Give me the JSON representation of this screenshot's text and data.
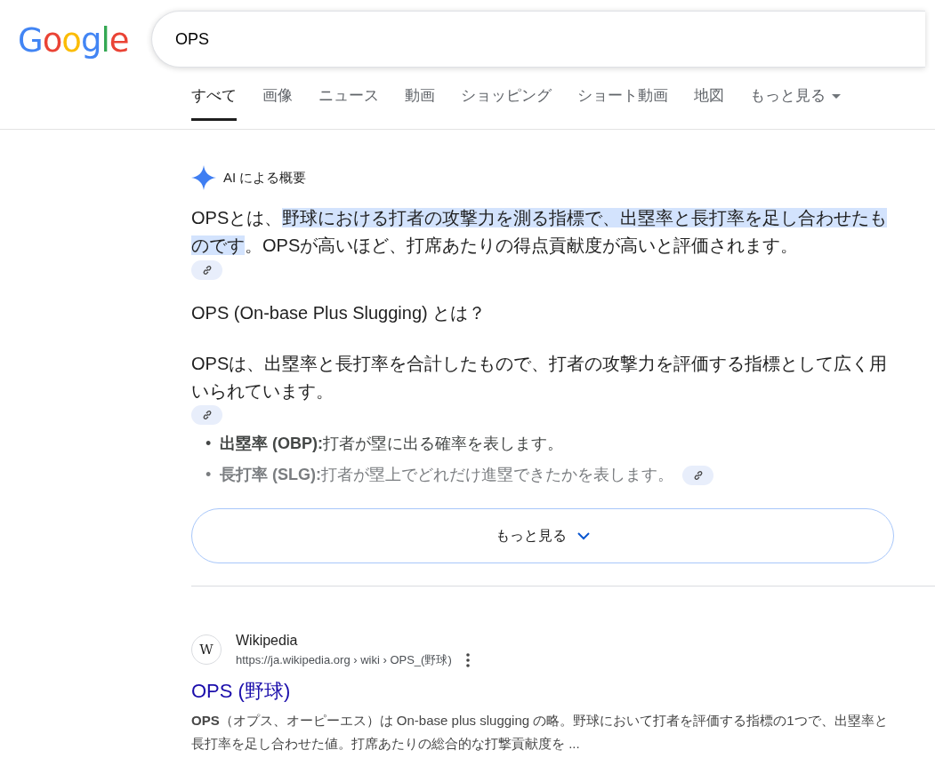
{
  "logo": "Google",
  "search": {
    "value": "OPS"
  },
  "tabs": [
    {
      "label": "すべて",
      "selected": true
    },
    {
      "label": "画像",
      "selected": false
    },
    {
      "label": "ニュース",
      "selected": false
    },
    {
      "label": "動画",
      "selected": false
    },
    {
      "label": "ショッピング",
      "selected": false
    },
    {
      "label": "ショート動画",
      "selected": false
    },
    {
      "label": "地図",
      "selected": false
    },
    {
      "label": "もっと見る",
      "selected": false,
      "kind": "dropdown"
    }
  ],
  "ai_overview": {
    "title": "AI による概要",
    "summary": [
      {
        "text": "OPSとは、",
        "highlighted": false
      },
      {
        "text": "野球における打者の攻撃力を測る指標で、出塁率と長打率を足し合わせたものです",
        "highlighted": true
      },
      {
        "text": "。OPSが高いほど、打席あたりの得点貢献度が高いと評価されます。",
        "highlighted": false
      }
    ],
    "heading": "OPS (On-base Plus Slugging) とは？",
    "paragraph": "OPSは、出塁率と長打率を合計したもので、打者の攻撃力を評価する指標として広く用いられています。",
    "bullets": [
      {
        "marker": "•",
        "text": "**出塁率 (OBP):**打者が塁に出る確率を表します。",
        "faded": false,
        "link": false
      },
      {
        "marker": "•",
        "text": "**長打率 (SLG):**打者が塁上でどれだけ進塁できたかを表します。",
        "faded": true,
        "link": true
      }
    ],
    "more_button": "もっと見る"
  },
  "result": {
    "favicon": "W",
    "site": "Wikipedia",
    "url": "https://ja.wikipedia.org › wiki › OPS_(野球)",
    "title": "OPS (野球)",
    "snippet": "**OPS**（オプス、オーピーエス）は On-base plus slugging の略。野球において打者を評価する指標の1つで、出塁率と長打率を足し合わせた値。打席あたりの総合的な打撃貢献度を ..."
  }
}
